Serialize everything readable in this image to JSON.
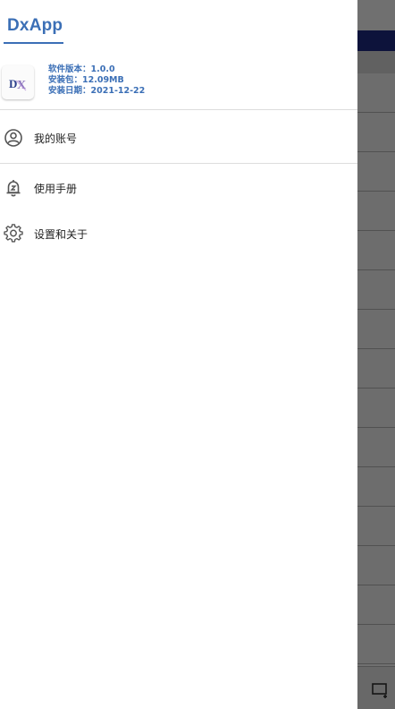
{
  "drawer": {
    "brand": "DxApp",
    "info": {
      "version": "软件版本：1.0.0",
      "package": "安装包：12.09MB",
      "install_date": "安装日期：2021-12-22"
    },
    "menu": [
      {
        "label": "我的账号",
        "icon": "account-circle-icon"
      },
      {
        "label": "使用手册",
        "icon": "bell-manual-icon"
      },
      {
        "label": "设置和关于",
        "icon": "gear-icon"
      }
    ]
  },
  "colors": {
    "accent": "#3b6fb6",
    "app_bar": "#1f2c86",
    "scrim": "rgba(0,0,0,0.56)"
  }
}
